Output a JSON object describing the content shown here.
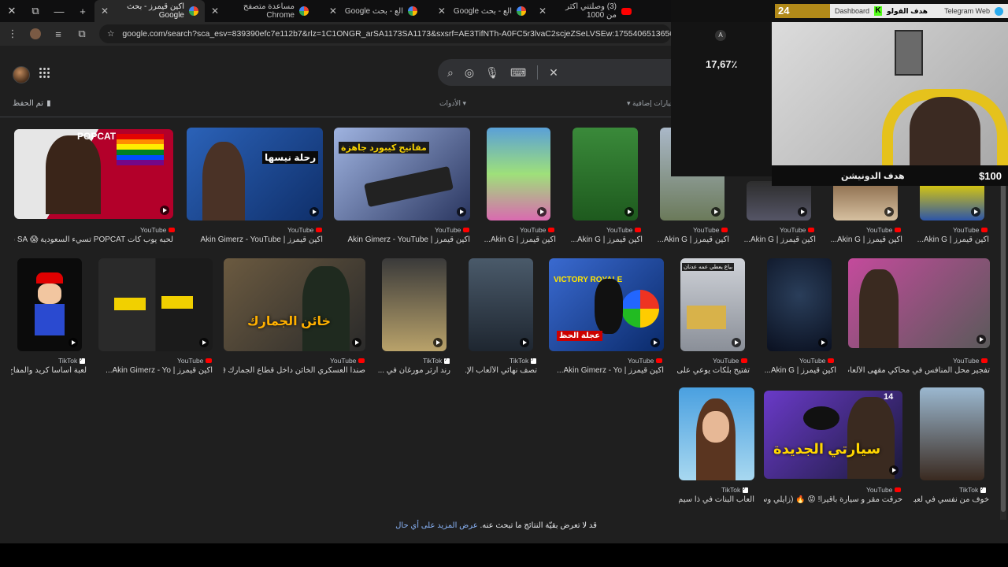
{
  "tabs": [
    {
      "title": "اكين قيمرز - بحث Google",
      "active": true
    },
    {
      "title": "مساعدة متصفح Chrome",
      "active": false
    },
    {
      "title": "الع - بحث Google",
      "active": false
    },
    {
      "title": "الع - بحث Google",
      "active": false
    },
    {
      "title": "(3) وصلتني اكثر من 1000",
      "active": false
    }
  ],
  "window_controls": {
    "close": "✕",
    "restore": "⧉",
    "minimize": "—",
    "new_tab": "+"
  },
  "address": {
    "url": "google.com/search?sca_esv=839390efc7e112b7&rlz=1C1ONGR_arSA1173SA1173&sxsrf=AE3TifNTh-A0FC5r3lvaC2scjeZSeLVSEw:1755406513650&udm=2&fbs=AlljpHy0W"
  },
  "header": {
    "saved_label": "تم الحفظ",
    "tools_label": "الأدوات",
    "more_options_label": "خيارات إضافية"
  },
  "results_row1": [
    {
      "source": "YouTube",
      "title": "لحبه يوب كات POPCAT تسيء السعودية 😱 SA شاه..."
    },
    {
      "source": "YouTube",
      "title": "اكين قيمرز | Akin Gimerz - YouTube"
    },
    {
      "source": "YouTube",
      "title": "اكين قيمرز | Akin Gimerz - YouTube"
    },
    {
      "source": "YouTube",
      "title": "اكين قيمرز | Akin G..."
    },
    {
      "source": "YouTube",
      "title": "اكين قيمرز | Akin G..."
    },
    {
      "source": "YouTube",
      "title": "اكين قيمرز | Akin G..."
    },
    {
      "source": "YouTube",
      "title": "اكين قيمرز | Akin G..."
    },
    {
      "source": "YouTube",
      "title": "اكين قيمرز | Akin G..."
    },
    {
      "source": "YouTube",
      "title": "اكين قيمرز | Akin G..."
    }
  ],
  "results_row2": [
    {
      "source": "TikTok",
      "title": "لعبة أساسا كريد والمفاج..."
    },
    {
      "source": "YouTube",
      "title": "اكين قيمرز | Akin Gimerz - Yo..."
    },
    {
      "source": "YouTube",
      "title": "صندا العسكري الخائن داخل قطاع الجمارك 😱"
    },
    {
      "source": "TikTok",
      "title": "رند آرثر مورغان في ..."
    },
    {
      "source": "TikTok",
      "title": "تصف نهائي الألعاب الإ..."
    },
    {
      "source": "YouTube",
      "title": "اكين قيمرز | Akin Gimerz - Yo..."
    },
    {
      "source": "YouTube",
      "title": "تفتيح بلكات يوعي على ..."
    },
    {
      "source": "YouTube",
      "title": "اكين قيمرز | Akin G..."
    },
    {
      "source": "YouTube",
      "title": "تفجير محل المنافس في محاكي مقهى الألعاب | ..."
    }
  ],
  "results_row3": [
    {
      "source": "TikTok",
      "title": "ألعاب البنات في ذا سيم..."
    },
    {
      "source": "YouTube",
      "title": "حرقت مقر و سيارة باقيرا! 😡 🔥 (زايلي وسـ..."
    },
    {
      "source": "TikTok",
      "title": "خوف من نفسي في لعبة..."
    }
  ],
  "thumb_texts": {
    "popcat": "POPCAT",
    "steve": "رحلة نيسها",
    "keyboard": "مفاتيح كيبورد جاهزة",
    "customs": "خائن الجمارك",
    "victory": "VICTORY ROYALE",
    "wheel": "عجلة الحظ",
    "car": "سيارتي الجديدة",
    "car_age": "14",
    "gold": "بياع يعطي عمه عدنان"
  },
  "footer": {
    "message": "قد لا تعرض بقيّة النتائج ما تبحث عنه.",
    "link": "عرض المزيد على أي حال"
  },
  "stream_overlay": {
    "counter": "24",
    "dashboard_text": "Dashboard",
    "kick_name": "هدف القولو",
    "telegram_text": "Telegram Web",
    "stat_value": "17,67٪",
    "goal_label": "هدف الدونيشن",
    "goal_amount": "$100"
  }
}
